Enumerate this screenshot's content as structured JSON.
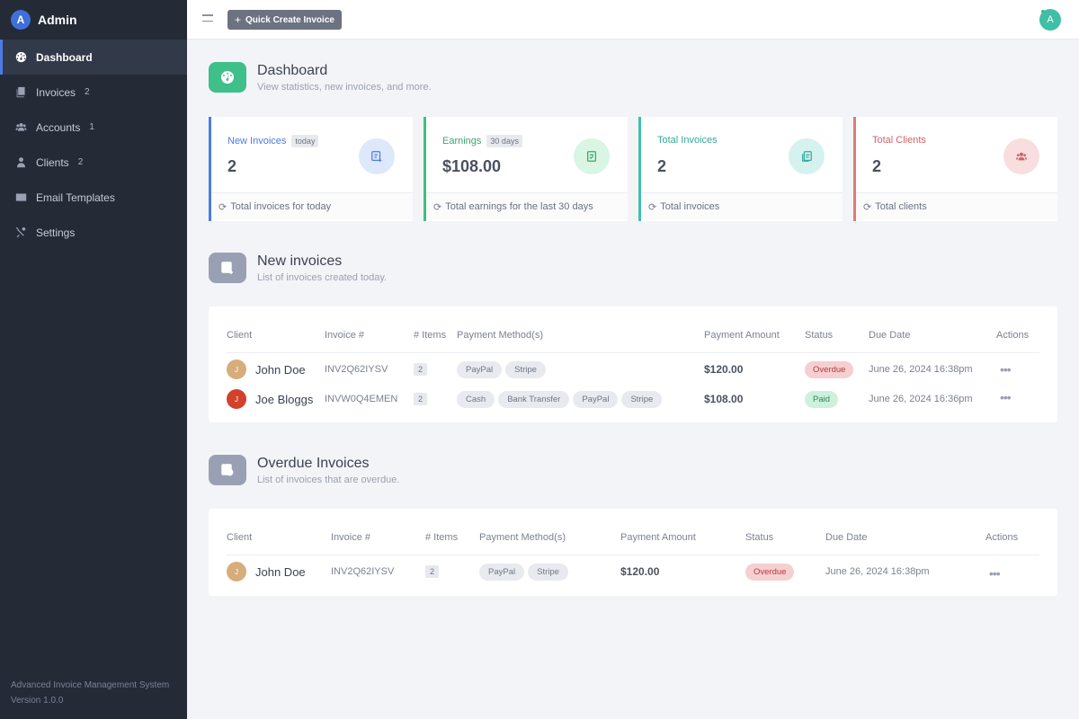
{
  "sidebar": {
    "brand_initial": "A",
    "brand_name": "Admin",
    "items": [
      {
        "label": "Dashboard",
        "count": ""
      },
      {
        "label": "Invoices",
        "count": "2"
      },
      {
        "label": "Accounts",
        "count": "1"
      },
      {
        "label": "Clients",
        "count": "2"
      },
      {
        "label": "Email Templates",
        "count": ""
      },
      {
        "label": "Settings",
        "count": ""
      }
    ],
    "footer_line1": "Advanced Invoice Management System",
    "footer_line2": "Version 1.0.0"
  },
  "topbar": {
    "quick_create_label": "Quick Create Invoice",
    "user_initial": "A"
  },
  "dashboard": {
    "title": "Dashboard",
    "subtitle": "View statistics, new invoices, and more."
  },
  "cards": [
    {
      "label": "New Invoices",
      "tag": "today",
      "value": "2",
      "footer": "Total invoices for today",
      "accent": "#4b7be5"
    },
    {
      "label": "Earnings",
      "tag": "30 days",
      "value": "$108.00",
      "footer": "Total earnings for the last 30 days",
      "accent": "#3fbf7f"
    },
    {
      "label": "Total Invoices",
      "tag": "",
      "value": "2",
      "footer": "Total invoices",
      "accent": "#3fbfae"
    },
    {
      "label": "Total Clients",
      "tag": "",
      "value": "2",
      "footer": "Total clients",
      "accent": "#e07a7a"
    }
  ],
  "new_invoices": {
    "title": "New invoices",
    "subtitle": "List of invoices created today.",
    "headers": [
      "Client",
      "Invoice #",
      "# Items",
      "Payment Method(s)",
      "Payment Amount",
      "Status",
      "Due Date",
      "Actions"
    ],
    "rows": [
      {
        "initial": "J",
        "client": "John Doe",
        "invoice": "INV2Q62IYSV",
        "items": "2",
        "methods": [
          "PayPal",
          "Stripe"
        ],
        "amount": "$120.00",
        "status": "Overdue",
        "due": "June 26, 2024 16:38pm"
      },
      {
        "initial": "J",
        "client": "Joe Bloggs",
        "invoice": "INVW0Q4EMEN",
        "items": "2",
        "methods": [
          "Cash",
          "Bank Transfer",
          "PayPal",
          "Stripe"
        ],
        "amount": "$108.00",
        "status": "Paid",
        "due": "June 26, 2024 16:36pm"
      }
    ]
  },
  "overdue_invoices": {
    "title": "Overdue Invoices",
    "subtitle": "List of invoices that are overdue.",
    "headers": [
      "Client",
      "Invoice #",
      "# Items",
      "Payment Method(s)",
      "Payment Amount",
      "Status",
      "Due Date",
      "Actions"
    ],
    "rows": [
      {
        "initial": "J",
        "client": "John Doe",
        "invoice": "INV2Q62IYSV",
        "items": "2",
        "methods": [
          "PayPal",
          "Stripe"
        ],
        "amount": "$120.00",
        "status": "Overdue",
        "due": "June 26, 2024 16:38pm"
      }
    ]
  },
  "colors": {
    "sidebar_bg": "#252a37",
    "accent_blue": "#4b7be5",
    "overdue": "#b43a40",
    "paid": "#2e8a52"
  },
  "icons": {
    "dashboard": "gauge-icon",
    "invoices": "invoice-icon",
    "accounts": "users-icon",
    "clients": "user-icon",
    "email": "envelope-icon",
    "settings": "tools-icon"
  }
}
